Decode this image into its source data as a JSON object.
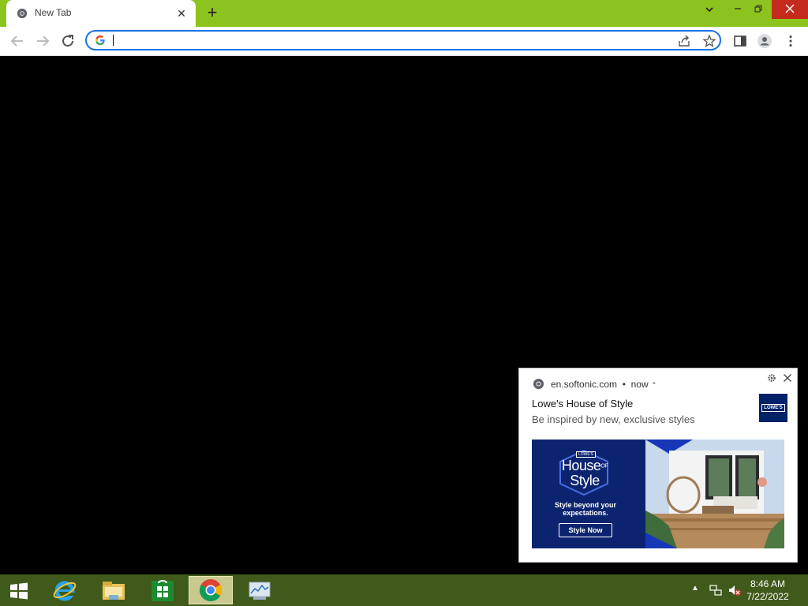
{
  "browser": {
    "tab": {
      "title": "New Tab"
    },
    "omnibox": {
      "value": "",
      "placeholder": ""
    }
  },
  "notification": {
    "source": "en.softonic.com",
    "time": "now",
    "title": "Lowe's House of Style",
    "body": "Be inspired by new, exclusive styles",
    "logo_text": "LOWE'S",
    "ad": {
      "badge_small": "LOWE'S",
      "headline_1": "House",
      "headline_of": "OF",
      "headline_2": "Style",
      "tagline": "Style beyond your expectations.",
      "button": "Style Now"
    }
  },
  "taskbar": {
    "clock_time": "8:46 AM",
    "clock_date": "7/22/2022"
  },
  "colors": {
    "titlebar": "#8dc31f",
    "taskbar": "#3f5a1a",
    "ad_blue": "#0c2470",
    "accent": "#1a73e8"
  }
}
